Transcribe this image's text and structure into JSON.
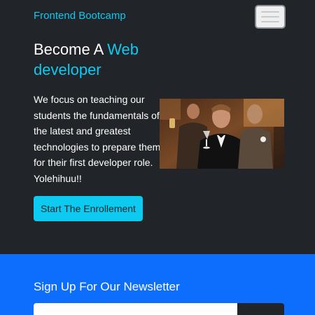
{
  "navbar": {
    "brand": "Frontend Bootcamp",
    "toggler_icon": "hamburger-menu-icon"
  },
  "hero": {
    "title_plain": "Become A ",
    "title_accent": "Web developer",
    "description": "We focus on teaching our students the fundamentals of the latest and greatest technologies to prepare them for their first developer role. Yolehihuu!!",
    "cta_label": "Start The Enrollement"
  },
  "newsletter": {
    "title": "Sign Up For Our Newsletter"
  },
  "colors": {
    "accent": "#0dcaf0",
    "background": "#212529",
    "newsletter_bg": "#0d6efd"
  }
}
